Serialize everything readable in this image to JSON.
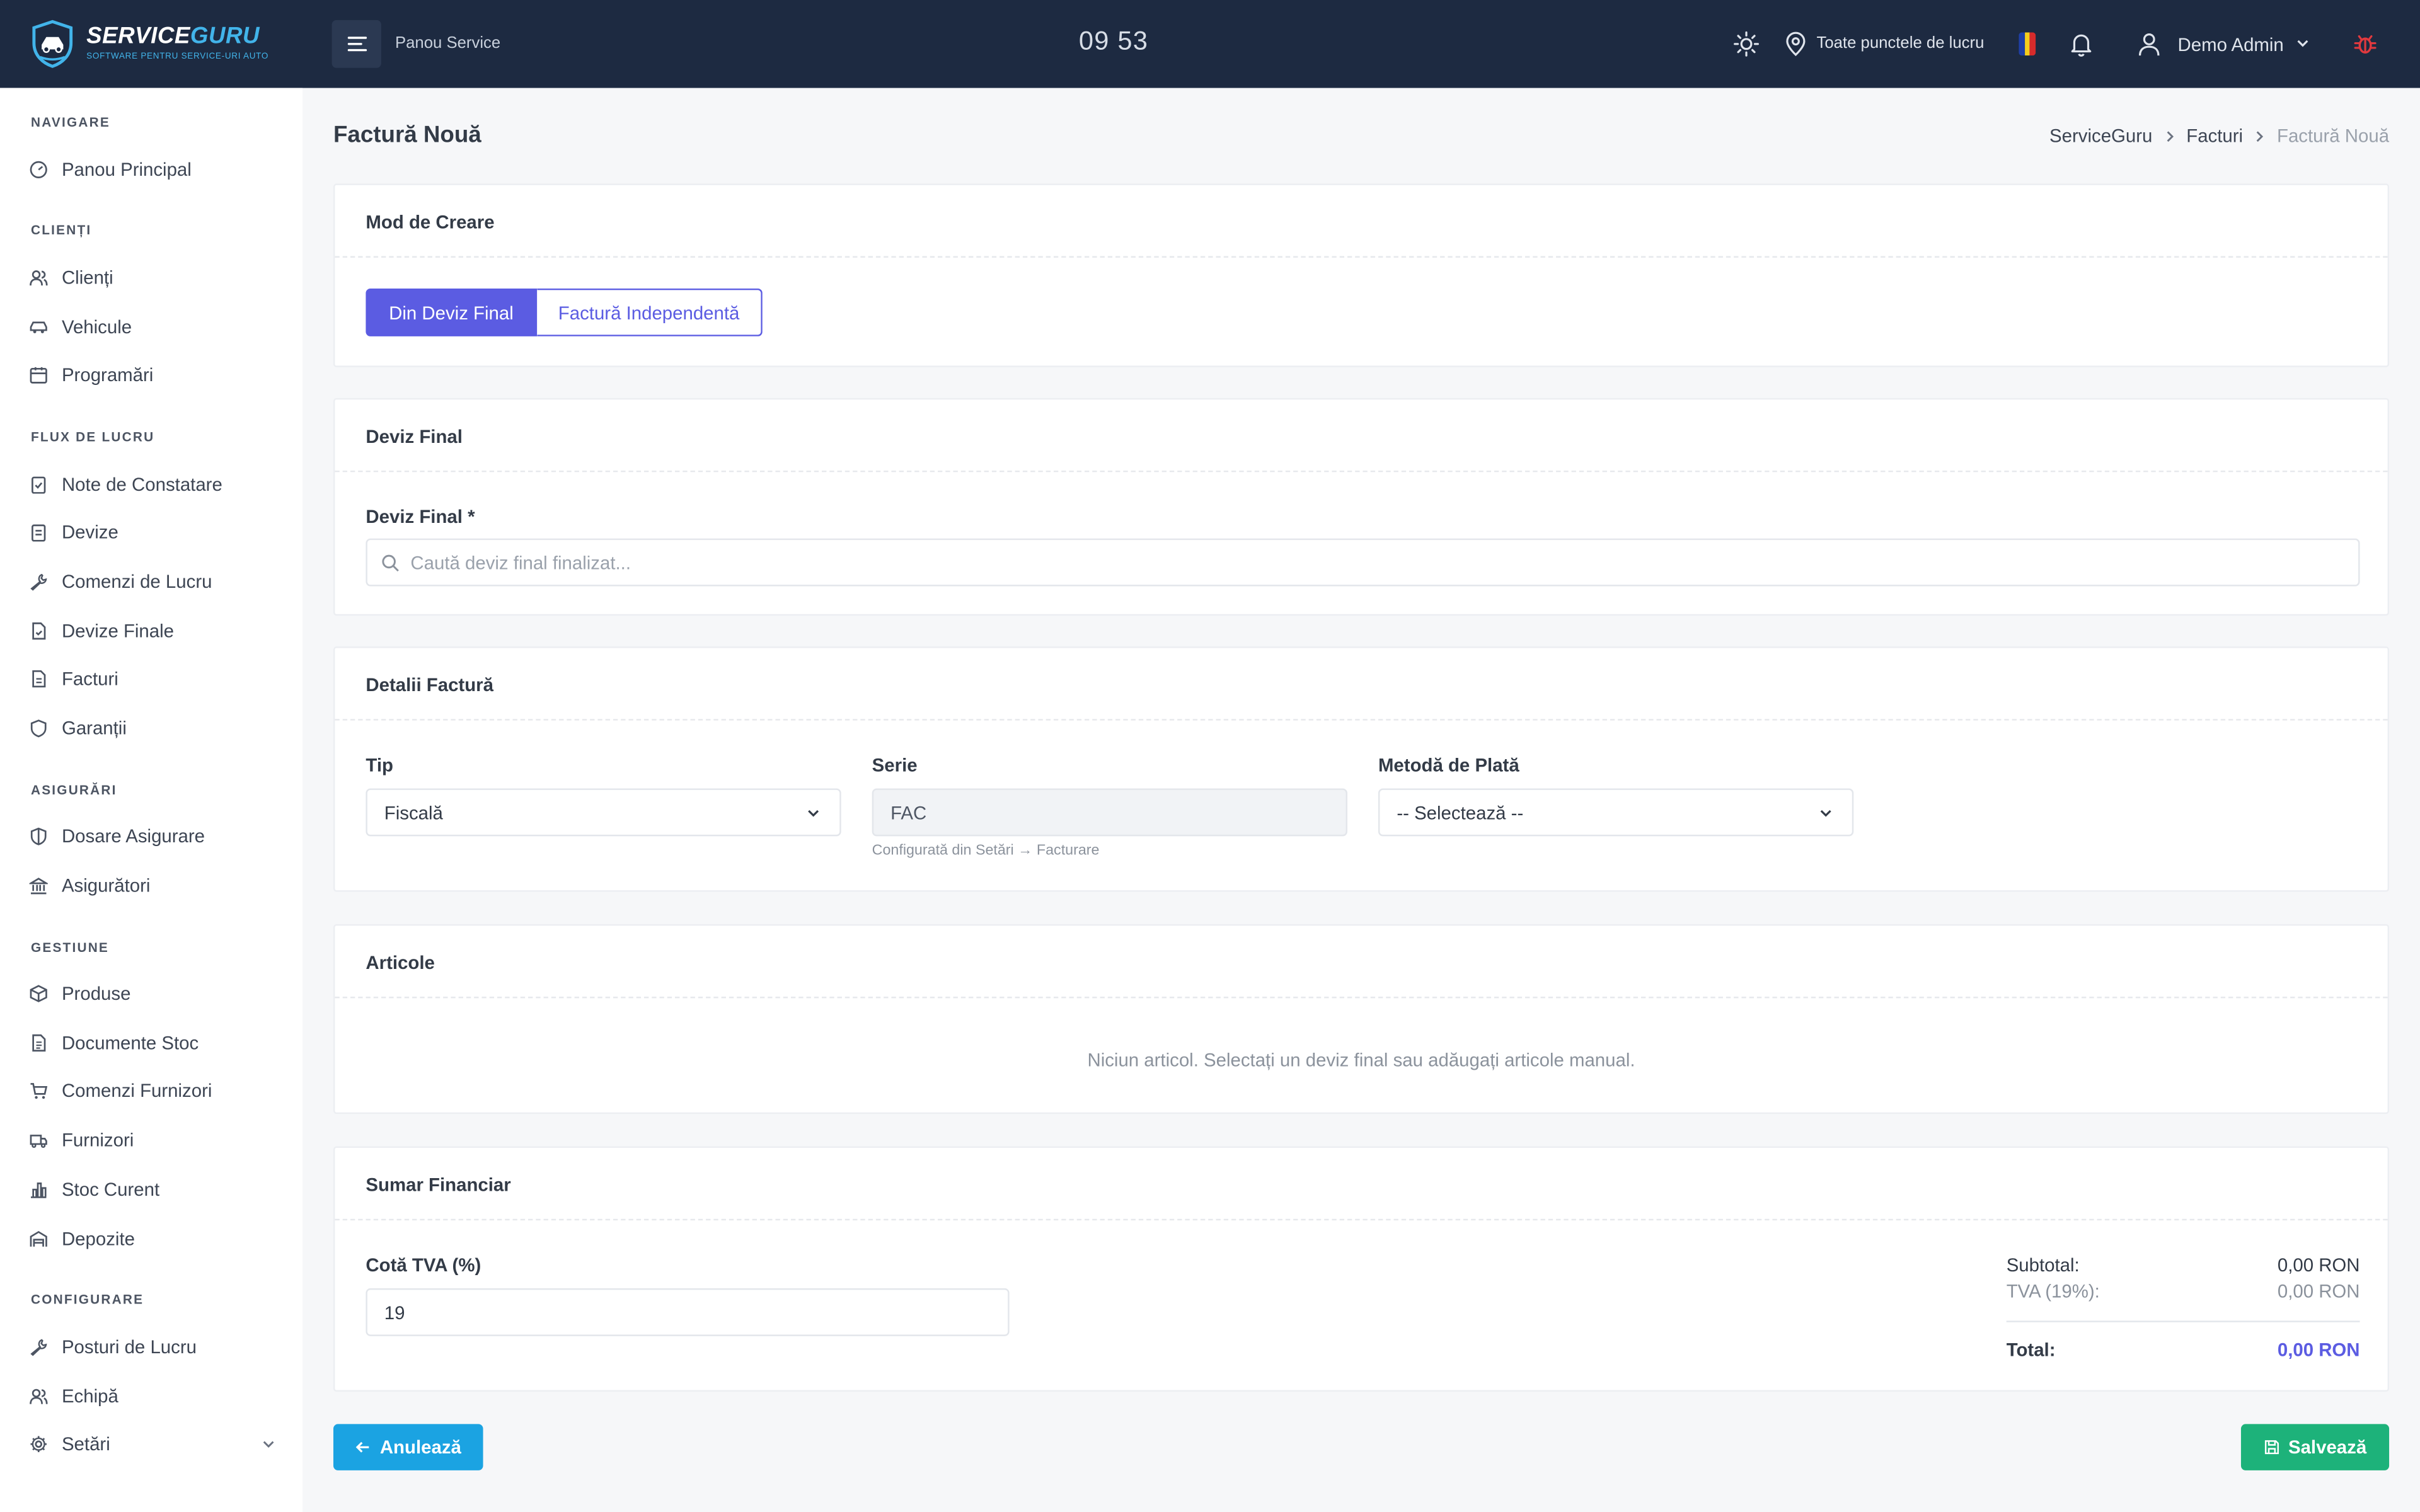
{
  "app": {
    "logo_name_part1": "SERVICE",
    "logo_name_part2": "GURU",
    "logo_tagline": "SOFTWARE PENTRU SERVICE-URI AUTO",
    "brand_color": "#42b4ea"
  },
  "topbar": {
    "panel_label": "Panou Service",
    "clock": "09 53",
    "location_label": "Toate punctele de lucru",
    "user_name": "Demo Admin",
    "icons": [
      "menu-icon",
      "sun-icon",
      "map-pin-icon",
      "flag-ro-icon",
      "bell-icon",
      "user-icon",
      "chevron-down-icon",
      "bug-icon"
    ]
  },
  "sidebar": {
    "sections": [
      {
        "title": "NAVIGARE",
        "items": [
          {
            "label": "Panou Principal",
            "icon": "dashboard-icon"
          }
        ]
      },
      {
        "title": "CLIENȚI",
        "items": [
          {
            "label": "Clienți",
            "icon": "users-icon"
          },
          {
            "label": "Vehicule",
            "icon": "car-icon"
          },
          {
            "label": "Programări",
            "icon": "calendar-icon"
          }
        ]
      },
      {
        "title": "FLUX DE LUCRU",
        "items": [
          {
            "label": "Note de Constatare",
            "icon": "clipboard-check-icon"
          },
          {
            "label": "Devize",
            "icon": "clipboard-icon"
          },
          {
            "label": "Comenzi de Lucru",
            "icon": "wrench-icon"
          },
          {
            "label": "Devize Finale",
            "icon": "file-check-icon"
          },
          {
            "label": "Facturi",
            "icon": "file-text-icon"
          },
          {
            "label": "Garanții",
            "icon": "shield-icon"
          }
        ]
      },
      {
        "title": "ASIGURĂRI",
        "items": [
          {
            "label": "Dosare Asigurare",
            "icon": "shield-half-icon"
          },
          {
            "label": "Asigurători",
            "icon": "bank-icon"
          }
        ]
      },
      {
        "title": "GESTIUNE",
        "items": [
          {
            "label": "Produse",
            "icon": "box-icon"
          },
          {
            "label": "Documente Stoc",
            "icon": "document-icon"
          },
          {
            "label": "Comenzi Furnizori",
            "icon": "cart-icon"
          },
          {
            "label": "Furnizori",
            "icon": "truck-icon"
          },
          {
            "label": "Stoc Curent",
            "icon": "bar-chart-icon"
          },
          {
            "label": "Depozite",
            "icon": "warehouse-icon"
          }
        ]
      },
      {
        "title": "CONFIGURARE",
        "items": [
          {
            "label": "Posturi de Lucru",
            "icon": "wrench-icon"
          },
          {
            "label": "Echipă",
            "icon": "team-icon"
          },
          {
            "label": "Setări",
            "icon": "gear-icon"
          }
        ]
      }
    ]
  },
  "page": {
    "title": "Factură Nouă",
    "breadcrumb": [
      "ServiceGuru",
      "Facturi",
      "Factură Nouă"
    ]
  },
  "creation_mode": {
    "heading": "Mod de Creare",
    "options": [
      "Din Deviz Final",
      "Factură Independentă"
    ],
    "selected": "Din Deviz Final",
    "accent_color": "#5b5ce2"
  },
  "final_estimate": {
    "heading": "Deviz Final",
    "field_label": "Deviz Final *",
    "search_placeholder": "Caută deviz final finalizat..."
  },
  "invoice_details": {
    "heading": "Detalii Factură",
    "type_label": "Tip",
    "type_value": "Fiscală",
    "series_label": "Serie",
    "series_value": "FAC",
    "series_hint": "Configurată din Setări → Facturare",
    "payment_label": "Metodă de Plată",
    "payment_value": "-- Selectează --"
  },
  "items": {
    "heading": "Articole",
    "empty_message": "Niciun articol. Selectați un deviz final sau adăugați articole manual."
  },
  "financial_summary": {
    "heading": "Sumar Financiar",
    "vat_label": "Cotă TVA (%)",
    "vat_value": "19",
    "subtotal_label": "Subtotal:",
    "subtotal_value": "0,00 RON",
    "vat_row_label": "TVA (19%):",
    "vat_row_value": "0,00 RON",
    "total_label": "Total:",
    "total_value": "0,00 RON"
  },
  "actions": {
    "cancel_label": "Anulează",
    "save_label": "Salvează",
    "cancel_color": "#1ba3e2",
    "save_color": "#1db27a"
  }
}
